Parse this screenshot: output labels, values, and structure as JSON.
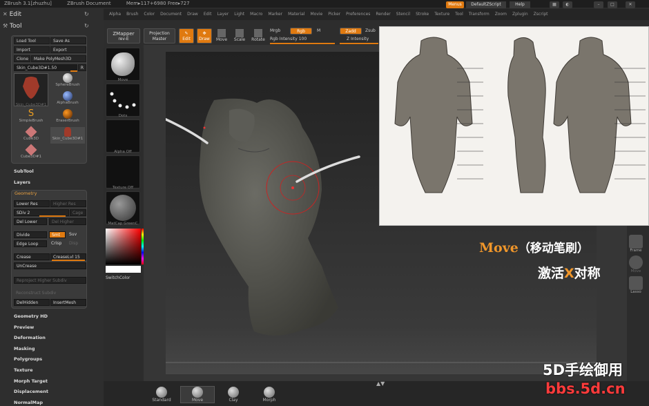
{
  "titlebar": {
    "app": "ZBrush 3.1[zhuzhu]",
    "doc": "ZBrush Document",
    "mem": "Mem▸117+6980 Free▸727",
    "menus": "Menus",
    "default_script": "DefaultZScript",
    "help": "Help"
  },
  "menubar": [
    "Alpha",
    "Brush",
    "Color",
    "Document",
    "Draw",
    "Edit",
    "Layer",
    "Light",
    "Macro",
    "Marker",
    "Material",
    "Movie",
    "Picker",
    "Preferences",
    "Render",
    "Stencil",
    "Stroke",
    "Texture",
    "Tool",
    "Transform",
    "Zoom",
    "Zplugin",
    "Zscript"
  ],
  "left": {
    "edit": "Edit",
    "tool": "Tool",
    "load_tool": "Load Tool",
    "save_as": "Save As",
    "import": "Import",
    "export": "Export",
    "clone": "Clone",
    "make_polymesh": "Make PolyMesh3D",
    "current_tool": "Skin_Cube3D#1.50",
    "r": "R",
    "thumbs": [
      "Skin_Cube3D#1",
      "SphereBrush",
      "AlphaBrush",
      "SimpleBrush",
      "EraserBrush",
      "Cube3D",
      "Skin_Cube3D#1",
      "Cube3D#1"
    ],
    "subtool": "SubTool",
    "layers": "Layers",
    "geometry": "Geometry",
    "lower_res": "Lower Res",
    "higher_res": "Higher Res",
    "sdiv": "SDiv 2",
    "cage": "Cage",
    "del_lower": "Del Lower",
    "del_higher": "Del Higher",
    "divide": "Divide",
    "smt": "Smt",
    "suv": "Suv",
    "edge_loop": "Edge Loop",
    "crisp": "Crisp",
    "disp": "Disp",
    "crease": "Crease",
    "crease_lvl": "CreaseLvl 15",
    "uncrease": "UnCrease",
    "reproject": "Reproject Higher Subdiv",
    "reconstruct": "Reconstruct Subdiv",
    "del_hidden": "DelHidden",
    "insert_mesh": "InsertMesh",
    "bottom_items": [
      "Geometry HD",
      "Preview",
      "Deformation",
      "Masking",
      "Polygroups",
      "Texture",
      "Morph Target",
      "Displacement",
      "NormalMap"
    ]
  },
  "shelf": {
    "zmapper": "ZMapper",
    "zmapper_sub": "rev-E",
    "projection": "Projection",
    "projection_sub": "Master",
    "edit": "Edit",
    "draw": "Draw",
    "move": "Move",
    "scale": "Scale",
    "rotate": "Rotate",
    "mrgb": "Mrgb",
    "rgb": "Rgb",
    "m": "M",
    "rgb_intensity": "Rgb Intensity 100",
    "zadd": "Zadd",
    "zsub": "Zsub",
    "z_intensity": "Z Intensity"
  },
  "shelf_thumbs": [
    "Move",
    "Dots",
    "Alpha Off",
    "Texture Off",
    "MatCap GreenC"
  ],
  "switchcolor": "SwitchColor",
  "right_tray": [
    "Frame",
    "Move",
    "Lasso"
  ],
  "captions": {
    "move": "Move",
    "move_cn": "（移动笔刷）",
    "sym_pre": "激活",
    "sym_x": "X",
    "sym_post": "对称"
  },
  "watermark": {
    "line1": "5D手绘御用",
    "line2": "bbs.5d.cn"
  },
  "bottom_brushes": [
    "Standard",
    "Move",
    "Clay",
    "Morph"
  ],
  "colors": {
    "accent": "#e07a10",
    "watermark_red": "#ff3b3b"
  }
}
